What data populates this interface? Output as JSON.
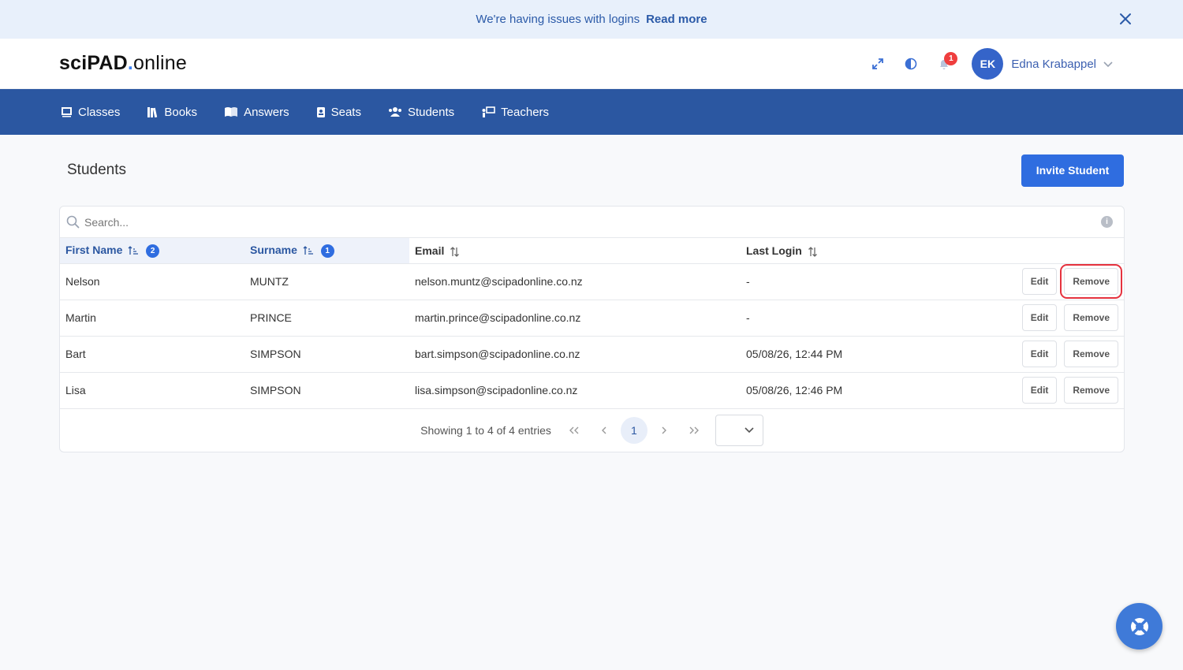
{
  "banner": {
    "message": "We're having issues with logins",
    "link": "Read more"
  },
  "header": {
    "logo": {
      "part1": "sciPAD",
      "dot": ".",
      "part2": "online"
    },
    "notifications_count": "1",
    "user": {
      "initials": "EK",
      "name": "Edna Krabappel"
    }
  },
  "nav": {
    "items": [
      {
        "label": "Classes",
        "icon": "classes-icon"
      },
      {
        "label": "Books",
        "icon": "books-icon"
      },
      {
        "label": "Answers",
        "icon": "answers-icon"
      },
      {
        "label": "Seats",
        "icon": "seats-icon"
      },
      {
        "label": "Students",
        "icon": "students-icon"
      },
      {
        "label": "Teachers",
        "icon": "teachers-icon"
      }
    ]
  },
  "page": {
    "title": "Students",
    "invite_button": "Invite Student"
  },
  "search": {
    "placeholder": "Search..."
  },
  "table": {
    "columns": [
      {
        "label": "First Name",
        "sort_order": "2"
      },
      {
        "label": "Surname",
        "sort_order": "1"
      },
      {
        "label": "Email"
      },
      {
        "label": "Last Login"
      }
    ],
    "rows": [
      {
        "first": "Nelson",
        "surname": "MUNTZ",
        "email": "nelson.muntz@scipadonline.co.nz",
        "last_login": "-"
      },
      {
        "first": "Martin",
        "surname": "PRINCE",
        "email": "martin.prince@scipadonline.co.nz",
        "last_login": "-"
      },
      {
        "first": "Bart",
        "surname": "SIMPSON",
        "email": "bart.simpson@scipadonline.co.nz",
        "last_login": "05/08/26, 12:44 PM"
      },
      {
        "first": "Lisa",
        "surname": "SIMPSON",
        "email": "lisa.simpson@scipadonline.co.nz",
        "last_login": "05/08/26, 12:46 PM"
      }
    ],
    "edit_label": "Edit",
    "remove_label": "Remove"
  },
  "pagination": {
    "info": "Showing 1 to 4 of 4 entries",
    "current_page": "1"
  },
  "colors": {
    "brand": "#2b57a1",
    "primary_button": "#2f6de0",
    "highlight": "#e5323e"
  }
}
